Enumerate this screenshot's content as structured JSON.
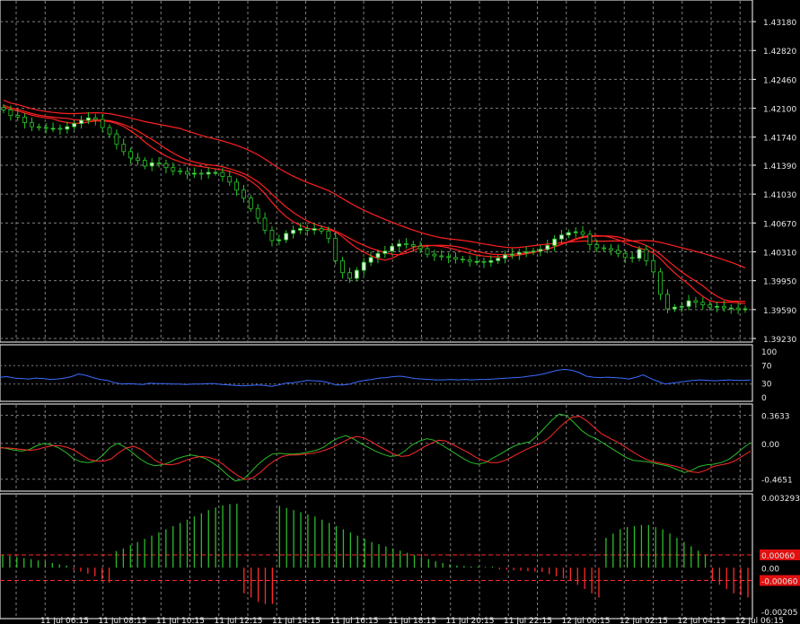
{
  "colors": {
    "background": "#000000",
    "grid": "#7f7f7f",
    "axis": "#ffffff",
    "candle_up": "#dff5df",
    "candle_down": "#000000",
    "wick": "#28c828",
    "ma": "#ff2020",
    "rsi": "#3b6cff",
    "osc_a": "#2bbb2b",
    "osc_b": "#ff2a2a",
    "hist_pos": "#2bbb2b",
    "hist_neg": "#ff2a2a",
    "level_box": "#e01010"
  },
  "chart_data": [
    {
      "type": "candlestick",
      "panel": "price",
      "y_ticks": [
        "1.43180",
        "1.42820",
        "1.42460",
        "1.42100",
        "1.41740",
        "1.41390",
        "1.41030",
        "1.40670",
        "1.40310",
        "1.39950",
        "1.39590",
        "1.39230"
      ],
      "ylim": [
        1.3923,
        1.4336
      ],
      "grid": true,
      "close": [
        1.4208,
        1.4201,
        1.4199,
        1.4192,
        1.4187,
        1.4186,
        1.4185,
        1.4185,
        1.4184,
        1.4187,
        1.4191,
        1.4195,
        1.4198,
        1.4196,
        1.4186,
        1.4178,
        1.4165,
        1.4156,
        1.4148,
        1.4145,
        1.4138,
        1.4142,
        1.4141,
        1.4136,
        1.4132,
        1.4131,
        1.4128,
        1.4129,
        1.4128,
        1.413,
        1.413,
        1.4125,
        1.4118,
        1.4108,
        1.4098,
        1.4085,
        1.4073,
        1.4058,
        1.4045,
        1.4046,
        1.4054,
        1.4058,
        1.406,
        1.4058,
        1.406,
        1.4057,
        1.4048,
        1.402,
        1.4005,
        1.3998,
        1.4008,
        1.4018,
        1.4024,
        1.4029,
        1.4032,
        1.4038,
        1.4041,
        1.404,
        1.4038,
        1.4035,
        1.4028,
        1.4026,
        1.4025,
        1.4024,
        1.4022,
        1.4021,
        1.4019,
        1.4019,
        1.4018,
        1.402,
        1.4023,
        1.4027,
        1.4028,
        1.403,
        1.4031,
        1.4032,
        1.4034,
        1.4039,
        1.4047,
        1.4052,
        1.4055,
        1.4056,
        1.4053,
        1.404,
        1.4036,
        1.4035,
        1.4033,
        1.4029,
        1.4024,
        1.4023,
        1.4034,
        1.402,
        1.4006,
        1.3978,
        1.396,
        1.3962,
        1.3963,
        1.397,
        1.3968,
        1.3965,
        1.3962,
        1.3963,
        1.3961,
        1.3961,
        1.3959,
        1.396
      ]
    },
    {
      "type": "line",
      "panel": "rsi",
      "y_ticks": [
        "100",
        "70",
        "30",
        "0"
      ],
      "ylim": [
        0,
        100
      ],
      "values": [
        45,
        46,
        43,
        42,
        41,
        43,
        42,
        40,
        41,
        43,
        46,
        52,
        49,
        44,
        40,
        38,
        33,
        30,
        31,
        30,
        29,
        32,
        31,
        31,
        30,
        30,
        29,
        30,
        30,
        31,
        31,
        29,
        28,
        27,
        26,
        27,
        28,
        27,
        25,
        28,
        32,
        33,
        35,
        38,
        37,
        36,
        33,
        28,
        28,
        30,
        35,
        38,
        40,
        43,
        44,
        46,
        47,
        45,
        42,
        41,
        40,
        39,
        39,
        40,
        39,
        40,
        39,
        40,
        40,
        41,
        42,
        43,
        44,
        45,
        47,
        49,
        52,
        56,
        60,
        62,
        60,
        55,
        47,
        45,
        44,
        45,
        44,
        43,
        41,
        45,
        50,
        42,
        36,
        30,
        32,
        34,
        36,
        38,
        39,
        38,
        37,
        38,
        39,
        38,
        38,
        39
      ]
    },
    {
      "type": "line",
      "panel": "oscillator",
      "y_ticks": [
        "0.3633",
        "0.00",
        "-0.4651"
      ],
      "ylim": [
        -0.55,
        0.44
      ],
      "series": [
        {
          "values": [
            -0.05,
            -0.07,
            -0.09,
            -0.1,
            -0.08,
            -0.03,
            0.0,
            -0.02,
            -0.06,
            -0.12,
            -0.2,
            -0.24,
            -0.25,
            -0.23,
            -0.15,
            -0.05,
            0.0,
            -0.05,
            -0.12,
            -0.2,
            -0.26,
            -0.29,
            -0.28,
            -0.25,
            -0.2,
            -0.17,
            -0.15,
            -0.17,
            -0.2,
            -0.26,
            -0.33,
            -0.42,
            -0.49,
            -0.47,
            -0.38,
            -0.28,
            -0.2,
            -0.14,
            -0.13,
            -0.14,
            -0.14,
            -0.13,
            -0.11,
            -0.09,
            -0.05,
            0.02,
            0.07,
            0.1,
            0.06,
            0.0,
            -0.05,
            -0.1,
            -0.14,
            -0.17,
            -0.16,
            -0.1,
            -0.02,
            0.03,
            0.06,
            0.04,
            -0.02,
            -0.08,
            -0.14,
            -0.2,
            -0.25,
            -0.27,
            -0.25,
            -0.19,
            -0.14,
            -0.08,
            -0.03,
            0.0,
            0.02,
            0.1,
            0.2,
            0.3,
            0.38,
            0.36,
            0.27,
            0.17,
            0.1,
            0.06,
            0.0,
            -0.06,
            -0.12,
            -0.18,
            -0.22,
            -0.23,
            -0.24,
            -0.26,
            -0.28,
            -0.3,
            -0.34,
            -0.38,
            -0.35,
            -0.3,
            -0.28,
            -0.27,
            -0.25,
            -0.21,
            -0.14,
            -0.06,
            0.01
          ]
        },
        {
          "values": [
            -0.06,
            -0.06,
            -0.07,
            -0.08,
            -0.09,
            -0.08,
            -0.05,
            -0.03,
            -0.03,
            -0.05,
            -0.09,
            -0.15,
            -0.21,
            -0.23,
            -0.23,
            -0.2,
            -0.12,
            -0.06,
            -0.04,
            -0.08,
            -0.15,
            -0.23,
            -0.27,
            -0.28,
            -0.26,
            -0.22,
            -0.19,
            -0.17,
            -0.18,
            -0.21,
            -0.27,
            -0.35,
            -0.42,
            -0.47,
            -0.45,
            -0.38,
            -0.29,
            -0.22,
            -0.17,
            -0.15,
            -0.15,
            -0.14,
            -0.13,
            -0.11,
            -0.08,
            -0.04,
            0.01,
            0.06,
            0.09,
            0.07,
            0.02,
            -0.04,
            -0.09,
            -0.14,
            -0.17,
            -0.16,
            -0.11,
            -0.05,
            0.0,
            0.04,
            0.03,
            -0.02,
            -0.07,
            -0.12,
            -0.18,
            -0.22,
            -0.25,
            -0.25,
            -0.22,
            -0.17,
            -0.12,
            -0.07,
            -0.03,
            0.01,
            0.08,
            0.18,
            0.27,
            0.34,
            0.35,
            0.29,
            0.2,
            0.12,
            0.07,
            0.02,
            -0.04,
            -0.1,
            -0.16,
            -0.21,
            -0.24,
            -0.26,
            -0.28,
            -0.3,
            -0.33,
            -0.37,
            -0.38,
            -0.35,
            -0.3,
            -0.28,
            -0.26,
            -0.22,
            -0.16,
            -0.1
          ]
        }
      ]
    },
    {
      "type": "bar",
      "panel": "histogram",
      "y_ticks": [
        "0.003293",
        "0.00",
        "-0.00205"
      ],
      "ylim": [
        -0.00205,
        0.003293
      ],
      "levels": [
        "0.00060",
        "-0.00060"
      ],
      "values": [
        0.0006,
        0.00055,
        0.0005,
        0.00045,
        0.0004,
        0.00034,
        0.00028,
        0.00022,
        0.00016,
        0.0001,
        -0.0001,
        -0.00018,
        -0.00028,
        -0.0004,
        -0.00055,
        -0.0007,
        0.00078,
        0.0009,
        0.00105,
        0.0012,
        0.00135,
        0.0015,
        0.00165,
        0.0018,
        0.00195,
        0.0021,
        0.00225,
        0.0024,
        0.00255,
        0.0027,
        0.00282,
        0.00292,
        0.00298,
        0.003,
        -0.0012,
        -0.0014,
        -0.0016,
        -0.0017,
        -0.0017,
        0.0029,
        0.0028,
        0.0027,
        0.0026,
        0.0025,
        0.0024,
        0.00225,
        0.0021,
        0.00195,
        0.0018,
        0.00165,
        0.0015,
        0.00135,
        0.0012,
        0.0011,
        0.001,
        0.0009,
        0.0008,
        0.0007,
        0.0006,
        0.0005,
        0.0004,
        0.0003,
        0.00022,
        0.00016,
        0.0001,
        8e-05,
        6e-05,
        5e-05,
        4e-05,
        5e-05,
        -8e-05,
        -0.0001,
        -0.00012,
        -0.00014,
        -0.00016,
        -0.00018,
        -0.0002,
        -0.0003,
        -0.0004,
        -0.0005,
        -0.0006,
        -0.0008,
        -0.001,
        -0.0012,
        -0.0014,
        0.0014,
        0.0016,
        0.0018,
        0.0019,
        0.00195,
        0.002,
        0.002,
        0.0019,
        0.0018,
        0.0016,
        0.0014,
        0.0012,
        0.001,
        0.0008,
        0.0006,
        -0.0006,
        -0.0008,
        -0.001,
        -0.0012,
        -0.0013,
        -0.0014
      ]
    }
  ],
  "x_axis": {
    "labels": [
      "11 Jul 06:15",
      "11 Jul 08:15",
      "11 Jul 10:15",
      "11 Jul 12:15",
      "11 Jul 14:15",
      "11 Jul 16:15",
      "11 Jul 18:15",
      "11 Jul 20:15",
      "11 Jul 22:15",
      "12 Jul 00:15",
      "12 Jul 02:15",
      "12 Jul 04:15",
      "12 Jul 06:15"
    ]
  }
}
